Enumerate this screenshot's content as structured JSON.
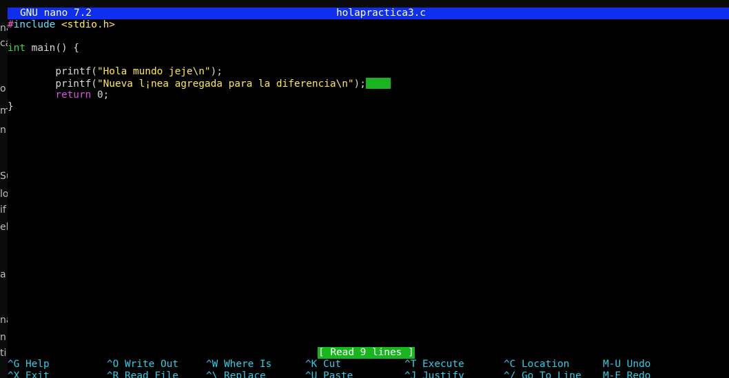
{
  "title_bar": {
    "app_version": "GNU nano 7.2",
    "filename": "holapractica3.c"
  },
  "code_lines": [
    {
      "hash": "#",
      "directive": "include",
      "rest": " <stdio.h>"
    },
    {
      "text": ""
    },
    {
      "type_kw": "int",
      "rest": " main() {"
    },
    {
      "text": ""
    },
    {
      "indent": "        ",
      "func": "printf(",
      "str": "\"Hola mundo jeje\\n\"",
      "end": ");"
    },
    {
      "indent": "        ",
      "func": "printf(",
      "str": "\"Nueva l¡nea agregada para la diferencia\\n\"",
      "end": ");"
    },
    {
      "indent": "        ",
      "kw": "return",
      "rest": " 0;"
    },
    {
      "text": "}"
    }
  ],
  "status_message": "[ Read 9 lines ]",
  "shortcuts": {
    "row1": [
      {
        "key": "^G",
        "label": "Help"
      },
      {
        "key": "^O",
        "label": "Write Out"
      },
      {
        "key": "^W",
        "label": "Where Is"
      },
      {
        "key": "^K",
        "label": "Cut"
      },
      {
        "key": "^T",
        "label": "Execute"
      },
      {
        "key": "^C",
        "label": "Location"
      },
      {
        "key": "M-U",
        "label": "Undo"
      }
    ],
    "row2": [
      {
        "key": "^X",
        "label": "Exit"
      },
      {
        "key": "^R",
        "label": "Read File"
      },
      {
        "key": "^\\",
        "label": "Replace"
      },
      {
        "key": "^U",
        "label": "Paste"
      },
      {
        "key": "^J",
        "label": "Justify"
      },
      {
        "key": "^/",
        "label": "Go To Line"
      },
      {
        "key": "M-E",
        "label": "Redo"
      }
    ]
  },
  "left_edge_fragments": [
    "na",
    "ca",
    "o",
    "m",
    "n",
    "Su",
    "lo",
    "if",
    "el",
    "a",
    "na",
    "n",
    "ti"
  ],
  "colors": {
    "title_bar_bg": "#0f2ff0",
    "status_bg": "#19b51e",
    "string": "#ffe94a",
    "type_keyword": "#33d94a",
    "control_keyword": "#d452e0",
    "preprocessor": "#63e0ff",
    "shortcut": "#2dcfe8"
  }
}
